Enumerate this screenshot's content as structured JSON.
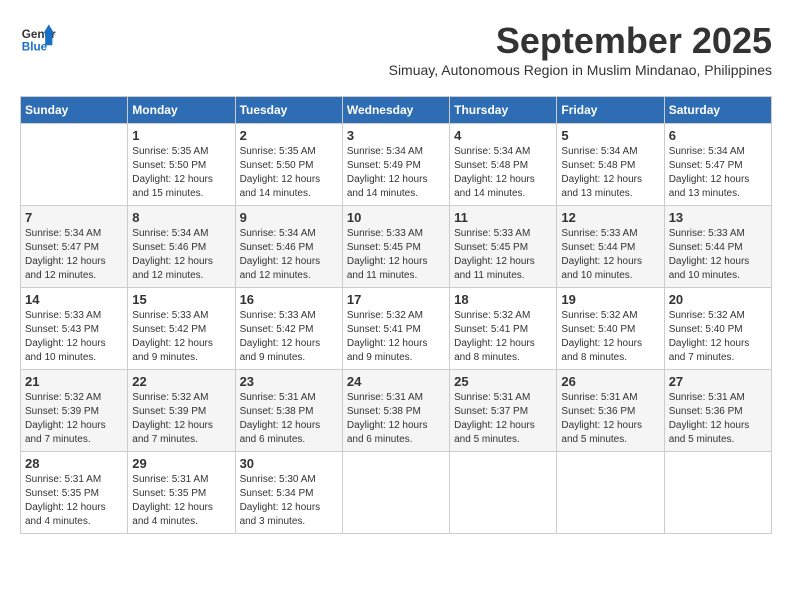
{
  "header": {
    "logo_line1": "General",
    "logo_line2": "Blue",
    "month_title": "September 2025",
    "subtitle": "Simuay, Autonomous Region in Muslim Mindanao, Philippines"
  },
  "days_of_week": [
    "Sunday",
    "Monday",
    "Tuesday",
    "Wednesday",
    "Thursday",
    "Friday",
    "Saturday"
  ],
  "weeks": [
    [
      {
        "day": "",
        "info": ""
      },
      {
        "day": "1",
        "info": "Sunrise: 5:35 AM\nSunset: 5:50 PM\nDaylight: 12 hours\nand 15 minutes."
      },
      {
        "day": "2",
        "info": "Sunrise: 5:35 AM\nSunset: 5:50 PM\nDaylight: 12 hours\nand 14 minutes."
      },
      {
        "day": "3",
        "info": "Sunrise: 5:34 AM\nSunset: 5:49 PM\nDaylight: 12 hours\nand 14 minutes."
      },
      {
        "day": "4",
        "info": "Sunrise: 5:34 AM\nSunset: 5:48 PM\nDaylight: 12 hours\nand 14 minutes."
      },
      {
        "day": "5",
        "info": "Sunrise: 5:34 AM\nSunset: 5:48 PM\nDaylight: 12 hours\nand 13 minutes."
      },
      {
        "day": "6",
        "info": "Sunrise: 5:34 AM\nSunset: 5:47 PM\nDaylight: 12 hours\nand 13 minutes."
      }
    ],
    [
      {
        "day": "7",
        "info": "Sunrise: 5:34 AM\nSunset: 5:47 PM\nDaylight: 12 hours\nand 12 minutes."
      },
      {
        "day": "8",
        "info": "Sunrise: 5:34 AM\nSunset: 5:46 PM\nDaylight: 12 hours\nand 12 minutes."
      },
      {
        "day": "9",
        "info": "Sunrise: 5:34 AM\nSunset: 5:46 PM\nDaylight: 12 hours\nand 12 minutes."
      },
      {
        "day": "10",
        "info": "Sunrise: 5:33 AM\nSunset: 5:45 PM\nDaylight: 12 hours\nand 11 minutes."
      },
      {
        "day": "11",
        "info": "Sunrise: 5:33 AM\nSunset: 5:45 PM\nDaylight: 12 hours\nand 11 minutes."
      },
      {
        "day": "12",
        "info": "Sunrise: 5:33 AM\nSunset: 5:44 PM\nDaylight: 12 hours\nand 10 minutes."
      },
      {
        "day": "13",
        "info": "Sunrise: 5:33 AM\nSunset: 5:44 PM\nDaylight: 12 hours\nand 10 minutes."
      }
    ],
    [
      {
        "day": "14",
        "info": "Sunrise: 5:33 AM\nSunset: 5:43 PM\nDaylight: 12 hours\nand 10 minutes."
      },
      {
        "day": "15",
        "info": "Sunrise: 5:33 AM\nSunset: 5:42 PM\nDaylight: 12 hours\nand 9 minutes."
      },
      {
        "day": "16",
        "info": "Sunrise: 5:33 AM\nSunset: 5:42 PM\nDaylight: 12 hours\nand 9 minutes."
      },
      {
        "day": "17",
        "info": "Sunrise: 5:32 AM\nSunset: 5:41 PM\nDaylight: 12 hours\nand 9 minutes."
      },
      {
        "day": "18",
        "info": "Sunrise: 5:32 AM\nSunset: 5:41 PM\nDaylight: 12 hours\nand 8 minutes."
      },
      {
        "day": "19",
        "info": "Sunrise: 5:32 AM\nSunset: 5:40 PM\nDaylight: 12 hours\nand 8 minutes."
      },
      {
        "day": "20",
        "info": "Sunrise: 5:32 AM\nSunset: 5:40 PM\nDaylight: 12 hours\nand 7 minutes."
      }
    ],
    [
      {
        "day": "21",
        "info": "Sunrise: 5:32 AM\nSunset: 5:39 PM\nDaylight: 12 hours\nand 7 minutes."
      },
      {
        "day": "22",
        "info": "Sunrise: 5:32 AM\nSunset: 5:39 PM\nDaylight: 12 hours\nand 7 minutes."
      },
      {
        "day": "23",
        "info": "Sunrise: 5:31 AM\nSunset: 5:38 PM\nDaylight: 12 hours\nand 6 minutes."
      },
      {
        "day": "24",
        "info": "Sunrise: 5:31 AM\nSunset: 5:38 PM\nDaylight: 12 hours\nand 6 minutes."
      },
      {
        "day": "25",
        "info": "Sunrise: 5:31 AM\nSunset: 5:37 PM\nDaylight: 12 hours\nand 5 minutes."
      },
      {
        "day": "26",
        "info": "Sunrise: 5:31 AM\nSunset: 5:36 PM\nDaylight: 12 hours\nand 5 minutes."
      },
      {
        "day": "27",
        "info": "Sunrise: 5:31 AM\nSunset: 5:36 PM\nDaylight: 12 hours\nand 5 minutes."
      }
    ],
    [
      {
        "day": "28",
        "info": "Sunrise: 5:31 AM\nSunset: 5:35 PM\nDaylight: 12 hours\nand 4 minutes."
      },
      {
        "day": "29",
        "info": "Sunrise: 5:31 AM\nSunset: 5:35 PM\nDaylight: 12 hours\nand 4 minutes."
      },
      {
        "day": "30",
        "info": "Sunrise: 5:30 AM\nSunset: 5:34 PM\nDaylight: 12 hours\nand 3 minutes."
      },
      {
        "day": "",
        "info": ""
      },
      {
        "day": "",
        "info": ""
      },
      {
        "day": "",
        "info": ""
      },
      {
        "day": "",
        "info": ""
      }
    ]
  ]
}
